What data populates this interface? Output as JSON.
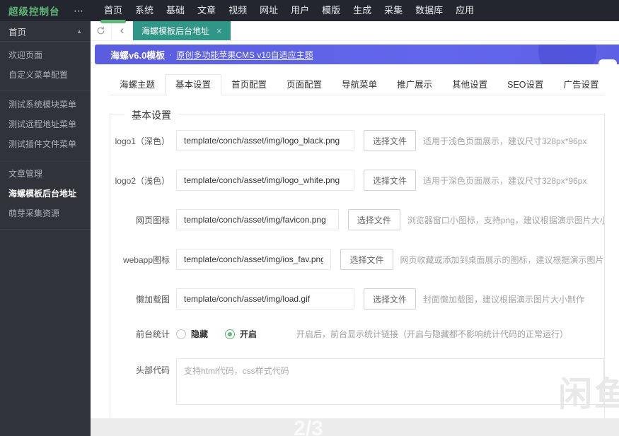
{
  "header": {
    "logo": "超级控制台",
    "more_icon": "⋯",
    "nav": [
      {
        "label": "首页"
      },
      {
        "label": "系统"
      },
      {
        "label": "基础"
      },
      {
        "label": "文章"
      },
      {
        "label": "视频"
      },
      {
        "label": "网址"
      },
      {
        "label": "用户"
      },
      {
        "label": "模版"
      },
      {
        "label": "生成"
      },
      {
        "label": "采集"
      },
      {
        "label": "数据库"
      },
      {
        "label": "应用"
      }
    ],
    "active_nav": "首页"
  },
  "sidebar": {
    "header": {
      "label": "首页",
      "arrow": "▲"
    },
    "groups": [
      {
        "items": [
          {
            "label": "欢迎页面"
          },
          {
            "label": "自定义菜单配置"
          }
        ]
      },
      {
        "items": [
          {
            "label": "测试系统模块菜单"
          },
          {
            "label": "测试远程地址菜单"
          },
          {
            "label": "测试插件文件菜单"
          }
        ]
      },
      {
        "items": [
          {
            "label": "文章管理"
          },
          {
            "label": "海螺模板后台地址"
          },
          {
            "label": "萌芽采集资源"
          }
        ]
      }
    ],
    "active_item": "海螺模板后台地址"
  },
  "tabbar": {
    "back_icon": "‹",
    "active_tab": {
      "label": "海螺模板后台地址",
      "close": "×"
    }
  },
  "banner": {
    "title": "海螺v6.0模板",
    "separator": "·",
    "subtitle": "原创多功能苹果CMS v10自适应主题"
  },
  "tabs": {
    "active": "基本设置",
    "items": [
      {
        "label": "海螺主题"
      },
      {
        "label": "基本设置"
      },
      {
        "label": "首页配置"
      },
      {
        "label": "页面配置"
      },
      {
        "label": "导航菜单"
      },
      {
        "label": "推广展示"
      },
      {
        "label": "其他设置"
      },
      {
        "label": "SEO设置"
      },
      {
        "label": "广告设置"
      }
    ]
  },
  "section": {
    "legend": "基本设置"
  },
  "form": {
    "rows": [
      {
        "label": "logo1（深色）",
        "value": "template/conch/asset/img/logo_black.png",
        "button": "选择文件",
        "hint": "适用于浅色页面展示，建议尺寸328px*96px"
      },
      {
        "label": "logo2（浅色）",
        "value": "template/conch/asset/img/logo_white.png",
        "button": "选择文件",
        "hint": "适用于深色页面展示，建议尺寸328px*96px"
      },
      {
        "label": "网页图标",
        "value": "template/conch/asset/img/favicon.png",
        "button": "选择文件",
        "hint": "浏览器窗口小图标，支持png，建议根据演示图片大小制作"
      },
      {
        "label": "webapp图标",
        "value": "template/conch/asset/img/ios_fav.png",
        "button": "选择文件",
        "hint": "网页收藏或添加到桌面展示的图标，建议根据演示图片大小制作"
      },
      {
        "label": "懒加载图",
        "value": "template/conch/asset/img/load.gif",
        "button": "选择文件",
        "hint": "封面懒加载图，建议根据演示图片大小制作"
      }
    ],
    "stats": {
      "label": "前台统计",
      "option_hide": "隐藏",
      "option_show": "开启",
      "selected": "开启",
      "hint": "开启后，前台显示统计链接（开启与隐藏都不影响统计代码的正常运行）"
    },
    "head_code": {
      "label": "头部代码",
      "placeholder": "支持html代码，css样式代码"
    }
  },
  "watermark": "闲鱼",
  "footer": {
    "page_indicator": "2/3"
  },
  "colors": {
    "accent_green": "#5fb878",
    "tab_green": "#2f9688",
    "banner_purple": "#5d61e6",
    "header_dark": "#23262e",
    "sidebar_dark": "#30333a"
  }
}
